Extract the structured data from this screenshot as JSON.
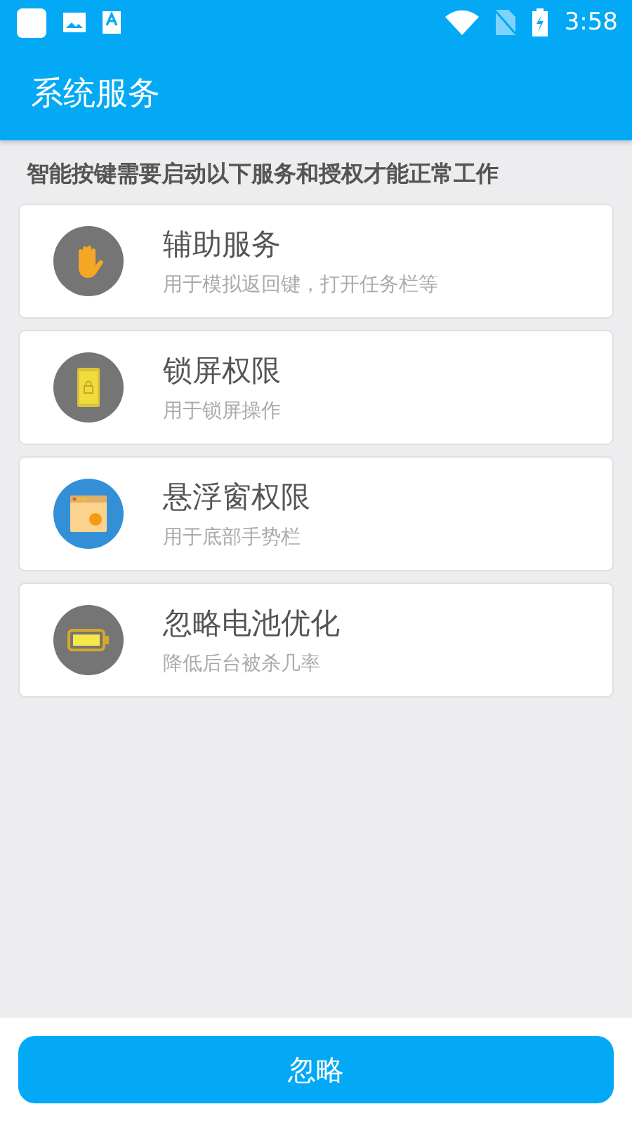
{
  "status_bar": {
    "time": "3:58"
  },
  "app_bar": {
    "title": "系统服务"
  },
  "intro": "智能按键需要启动以下服务和授权才能正常工作",
  "services": [
    {
      "kind": "hand",
      "color": "#757575",
      "title": "辅助服务",
      "subtitle": "用于模拟返回键，打开任务栏等"
    },
    {
      "kind": "lock",
      "color": "#757575",
      "title": "锁屏权限",
      "subtitle": "用于锁屏操作"
    },
    {
      "kind": "window",
      "color": "#3490d6",
      "title": "悬浮窗权限",
      "subtitle": "用于底部手势栏"
    },
    {
      "kind": "battery",
      "color": "#757575",
      "title": "忽略电池优化",
      "subtitle": "降低后台被杀几率"
    }
  ],
  "ignore_button": {
    "label": "忽略"
  }
}
